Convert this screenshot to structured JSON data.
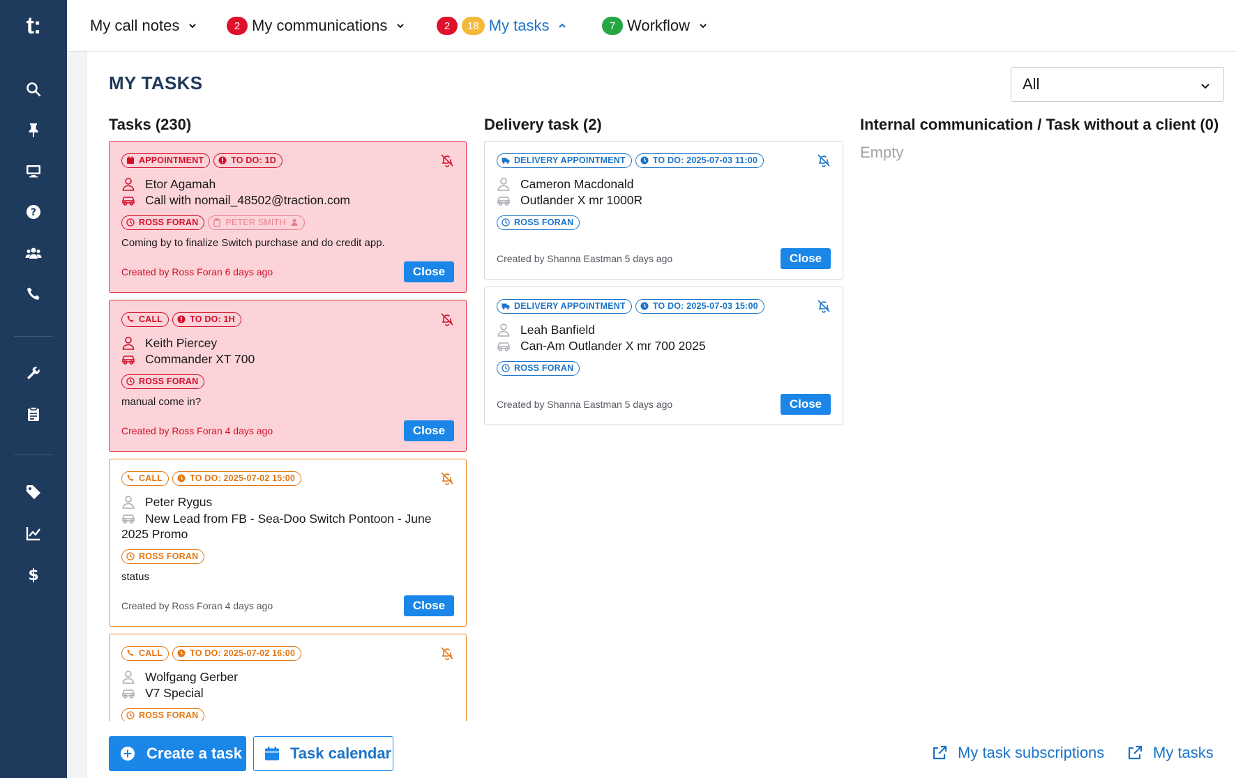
{
  "logo": {
    "text": "t",
    "dots": ":"
  },
  "colors": {
    "sidebar": "#1e3a5c",
    "accent": "#1a86e8",
    "red_card": "#fbd3d8",
    "red": "#e0112b",
    "orange": "#f08a1f",
    "green": "#27a644",
    "yellow": "#f5b93a"
  },
  "sidebar": {
    "items": [
      {
        "icon": "search-icon"
      },
      {
        "icon": "pin-icon"
      },
      {
        "icon": "monitor-icon"
      },
      {
        "icon": "help-icon"
      },
      {
        "icon": "users-icon"
      },
      {
        "icon": "phone-icon"
      },
      {
        "icon": "wrench-icon"
      },
      {
        "icon": "clipboard-icon"
      },
      {
        "icon": "tag-icon"
      },
      {
        "icon": "chart-icon"
      },
      {
        "icon": "dollar-icon"
      }
    ]
  },
  "nav": {
    "call_notes": "My call notes",
    "communications": {
      "badge": "2",
      "label": "My communications"
    },
    "tasks": {
      "badge_red": "2",
      "badge_yellow": "18",
      "label": "My tasks"
    },
    "workflow": {
      "badge": "7",
      "label": "Workflow"
    }
  },
  "page": {
    "title": "MY TASKS",
    "filter_value": "All"
  },
  "columns": {
    "tasks": {
      "title": "Tasks (230)"
    },
    "delivery": {
      "title": "Delivery task (2)"
    },
    "internal": {
      "title": "Internal communication / Task without a client (0)",
      "empty": "Empty"
    }
  },
  "tasks": [
    {
      "type": "APPOINTMENT",
      "todo": "TO DO: 1D",
      "client": "Etor Agamah",
      "subject": "Call with nomail_48502@traction.com",
      "owner": "ROSS FORAN",
      "assigned": "PETER SMITH",
      "description": "Coming by to finalize Switch purchase and do credit app.",
      "created": "Created by Ross Foran 6 days ago",
      "close": "Close"
    },
    {
      "type": "CALL",
      "todo": "TO DO: 1H",
      "client": "Keith Piercey",
      "subject": "Commander XT 700",
      "owner": "ROSS FORAN",
      "description": "manual come in?",
      "created": "Created by Ross Foran 4 days ago",
      "close": "Close"
    },
    {
      "type": "CALL",
      "todo": "TO DO: 2025-07-02 15:00",
      "client": "Peter Rygus",
      "subject": "New Lead from FB - Sea-Doo Switch Pontoon - June 2025 Promo",
      "owner": "ROSS FORAN",
      "description": "status",
      "created": "Created by Ross Foran 4 days ago",
      "close": "Close"
    },
    {
      "type": "CALL",
      "todo": "TO DO: 2025-07-02 16:00",
      "client": "Wolfgang Gerber",
      "subject": "V7 Special",
      "owner": "ROSS FORAN"
    }
  ],
  "delivery": [
    {
      "type": "DELIVERY APPOINTMENT",
      "todo": "TO DO: 2025-07-03 11:00",
      "client": "Cameron Macdonald",
      "subject": "Outlander X mr 1000R",
      "owner": "ROSS FORAN",
      "created": "Created by Shanna Eastman 5 days ago",
      "close": "Close"
    },
    {
      "type": "DELIVERY APPOINTMENT",
      "todo": "TO DO: 2025-07-03 15:00",
      "client": "Leah Banfield",
      "subject": "Can-Am Outlander X mr 700 2025",
      "owner": "ROSS FORAN",
      "created": "Created by Shanna Eastman 5 days ago",
      "close": "Close"
    }
  ],
  "bottom": {
    "create": "Create a task",
    "calendar": "Task calendar",
    "subscriptions": "My task subscriptions",
    "my_tasks": "My tasks"
  }
}
